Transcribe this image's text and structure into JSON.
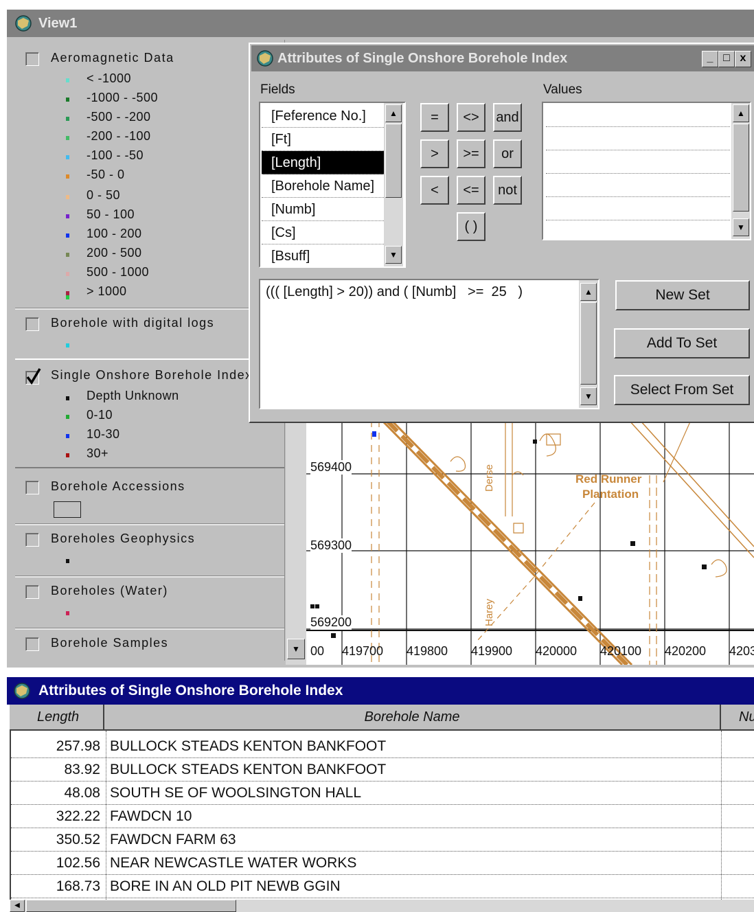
{
  "view_window": {
    "title": "View1"
  },
  "legend": {
    "themes": [
      {
        "name": "Aeromagnetic Data",
        "checked": false,
        "classes": [
          {
            "label": "< -1000",
            "color": "#66ddcc"
          },
          {
            "label": "-1000 - -500",
            "color": "#1a7a2a"
          },
          {
            "label": "-500 - -200",
            "color": "#2a9a55"
          },
          {
            "label": "-200 - -100",
            "color": "#44bb66"
          },
          {
            "label": "-100 - -50",
            "color": "#44bbee"
          },
          {
            "label": "-50 - 0",
            "color": "#dd8a2a"
          },
          {
            "label": "0 - 50",
            "color": "#eebb88"
          },
          {
            "label": "50 - 100",
            "color": "#7722cc"
          },
          {
            "label": "100 - 200",
            "color": "#1133ee"
          },
          {
            "label": "200 - 500",
            "color": "#778855"
          },
          {
            "label": "500 - 1000",
            "color": "#ddaaaa"
          },
          {
            "label": "> 1000",
            "color": "#aa2244"
          },
          {
            "label": "",
            "color": "#22cc44"
          }
        ]
      },
      {
        "name": "Borehole with digital logs",
        "checked": false,
        "symbol_color": "#22ccdd"
      },
      {
        "name": "Single Onshore Borehole Index",
        "checked": true,
        "classes": [
          {
            "label": "Depth Unknown",
            "color": "#111111"
          },
          {
            "label": "0-10",
            "color": "#22aa33"
          },
          {
            "label": "10-30",
            "color": "#1133ee"
          },
          {
            "label": "30+",
            "color": "#aa1111"
          }
        ]
      },
      {
        "name": "Borehole Accessions",
        "checked": false
      },
      {
        "name": "Boreholes Geophysics",
        "checked": false,
        "symbol_color": "#111111"
      },
      {
        "name": "Boreholes (Water)",
        "checked": false,
        "symbol_color": "#cc2255"
      },
      {
        "name": "Borehole Samples",
        "checked": false
      }
    ]
  },
  "map": {
    "northings": [
      "569400",
      "569300",
      "569200"
    ],
    "eastings": [
      "00",
      "419700",
      "419800",
      "419900",
      "420000",
      "420100",
      "420200",
      "4203"
    ],
    "place_labels": [
      "Red Runner",
      "Plantation",
      "Derse",
      "Harey"
    ],
    "feature_color": "#c8873a"
  },
  "query_dialog": {
    "title": "Attributes of Single Onshore Borehole Index",
    "fields_label": "Fields",
    "values_label": "Values",
    "fields": [
      "[Feference No.]",
      "[Ft]",
      "[Length]",
      "[Borehole Name]",
      "[Numb]",
      "[Cs]",
      "[Bsuff]"
    ],
    "selected_field": "[Length]",
    "operators": [
      "=",
      "<>",
      "and",
      ">",
      ">=",
      "or",
      "<",
      "<=",
      "not",
      "( )"
    ],
    "expression": "((( [Length] > 20)) and ( [Numb]   >=  25   )",
    "buttons": {
      "new_set": "New Set",
      "add_to_set": "Add To Set",
      "select_from_set": "Select From Set"
    },
    "window_controls": [
      "_",
      "□",
      "x"
    ]
  },
  "attribute_table": {
    "title": "Attributes of Single Onshore Borehole Index",
    "columns": [
      "Length",
      "Borehole Name",
      "Nu"
    ],
    "rows": [
      {
        "length": "257.98",
        "name": "BULLOCK STEADS KENTON BANKFOOT"
      },
      {
        "length": "83.92",
        "name": "BULLOCK STEADS KENTON BANKFOOT"
      },
      {
        "length": "48.08",
        "name": "SOUTH SE OF WOOLSINGTON HALL"
      },
      {
        "length": "322.22",
        "name": "FAWDCN 10"
      },
      {
        "length": "350.52",
        "name": "FAWDCN FARM 63"
      },
      {
        "length": "102.56",
        "name": "NEAR NEWCASTLE WATER WORKS"
      },
      {
        "length": "168.73",
        "name": "BORE IN AN OLD PIT NEWB GGIN"
      }
    ]
  }
}
